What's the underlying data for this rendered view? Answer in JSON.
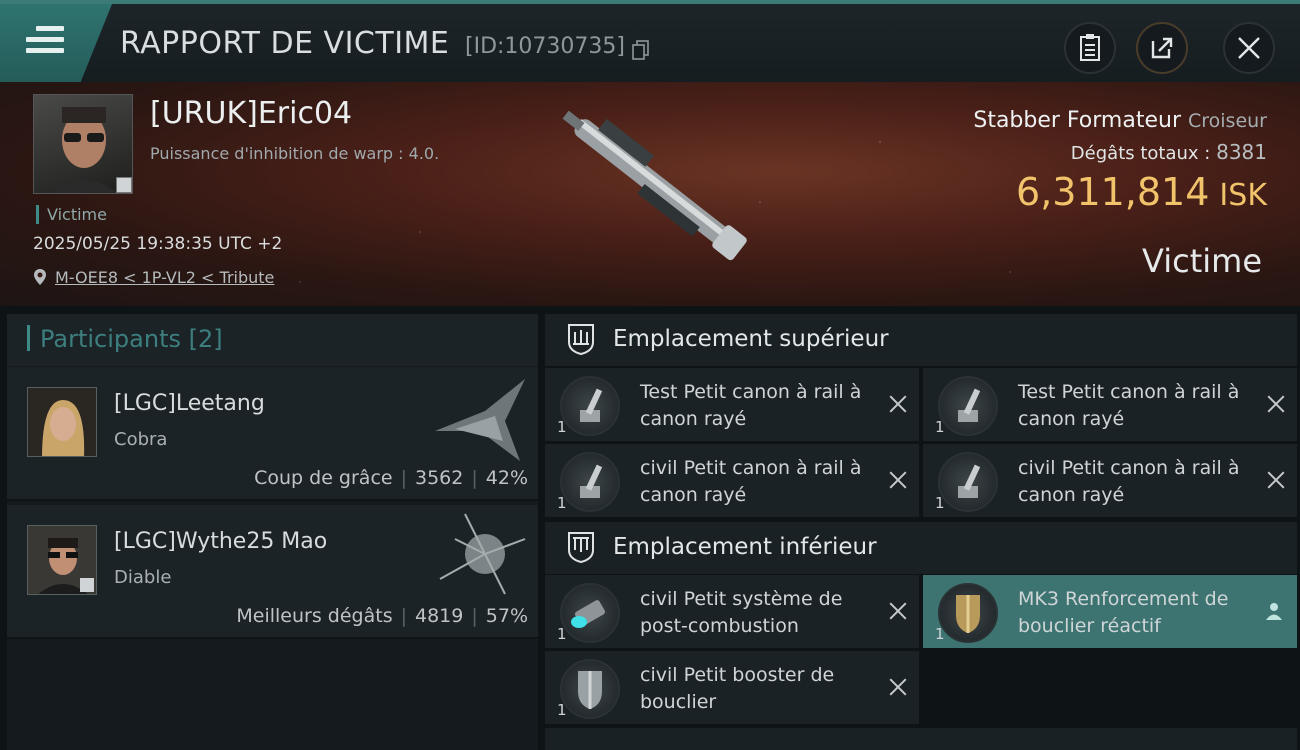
{
  "header": {
    "title": "RAPPORT DE VICTIME",
    "id": "[ID:10730735]",
    "accent": "#2f7470"
  },
  "victim": {
    "name": "[URUK]Eric04",
    "subtitle": "Puissance d'inhibition de warp : 4.0.",
    "tag": "Victime",
    "date": "2025/05/25 19:38:35 UTC +2",
    "location": "M-OEE8 < 1P-VL2 < Tribute",
    "ship_name": "Stabber Formateur",
    "ship_class": "Croiseur",
    "damage_label": "Dégâts totaux :",
    "damage_value": "8381",
    "isk_value": "6,311,814",
    "isk_unit": "ISK",
    "role_label": "Victime",
    "isk_color": "#f1c36b"
  },
  "participants": {
    "label": "Participants",
    "count": "[2]",
    "items": [
      {
        "name": "[LGC]Leetang",
        "ship": "Cobra",
        "stat_label": "Coup de grâce",
        "damage": "3562",
        "percent": "42%"
      },
      {
        "name": "[LGC]Wythe25 Mao",
        "ship": "Diable",
        "stat_label": "Meilleurs dégâts",
        "damage": "4819",
        "percent": "57%"
      }
    ]
  },
  "slots": {
    "upper": {
      "label": "Emplacement supérieur",
      "items": [
        {
          "name": "Test Petit canon à rail à canon rayé",
          "qty": "1"
        },
        {
          "name": "Test Petit canon à rail à canon rayé",
          "qty": "1"
        },
        {
          "name": "civil Petit canon à rail à canon rayé",
          "qty": "1"
        },
        {
          "name": "civil Petit canon à rail à canon rayé",
          "qty": "1"
        }
      ]
    },
    "lower": {
      "label": "Emplacement inférieur",
      "items": [
        {
          "name": "civil Petit système de post-combustion",
          "qty": "1"
        },
        {
          "name": "MK3 Renforcement de bouclier réactif",
          "qty": "1"
        },
        {
          "name": "civil Petit booster de bouclier",
          "qty": "1"
        }
      ]
    }
  }
}
